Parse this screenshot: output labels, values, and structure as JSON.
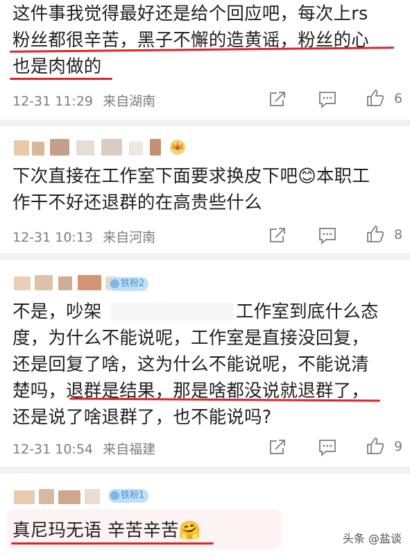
{
  "comments": [
    {
      "lines": [
        "这件事我觉得最好还是给个回应吧，每次上rs",
        "粉丝都很辛苦，黑子不懈的造黄谣，粉丝的心",
        "也是肉做的"
      ],
      "date": "12-31 11:29",
      "location": "来自湖南",
      "like_count": "6"
    },
    {
      "lines": [
        "下次直接在工作室下面要求换皮下吧😊本职工",
        "作干不好还退群的在高贵些什么"
      ],
      "date": "12-31 10:13",
      "location": "来自河南",
      "like_count": "8"
    },
    {
      "badge": "铁粉2",
      "lines": [
        "不是，吵架",
        "工作室到底什么态",
        "度，为什么不能说呢，工作室是直接没回复，",
        "还是回复了啥，这为什么不能说呢，不能说清",
        "楚吗，退群是结果，那是啥都没说就退群了，",
        "还是说了啥退群了，也不能说吗?"
      ],
      "date": "12-31 10:54",
      "location": "来自福建",
      "like_count": "9"
    },
    {
      "badge": "铁粉1",
      "lines": [
        "真尼玛无语 辛苦辛苦🤗"
      ]
    }
  ],
  "watermark": "头条 @盐谈",
  "colors": {
    "underline": "#d8252b",
    "meta_text": "#7d7d7d",
    "badge_bg": "#bfe0f7",
    "badge_text": "#4a8fd0"
  },
  "icons": [
    "share-icon",
    "comment-icon",
    "like-icon",
    "crown-icon",
    "fan-badge-icon"
  ]
}
